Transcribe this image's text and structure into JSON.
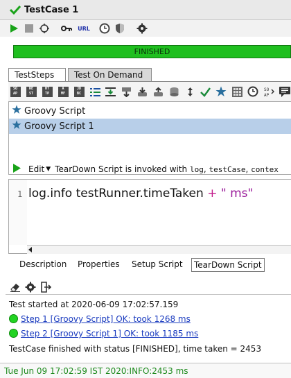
{
  "window": {
    "title": "TestCase 1"
  },
  "toolbar": {
    "icons": [
      "run-icon",
      "stop-icon",
      "loop-icon",
      "key-icon",
      "url-icon",
      "clock-icon",
      "shield-icon",
      "gear-icon"
    ],
    "url_label": "URL"
  },
  "progress": {
    "status": "FINISHED",
    "value": 1.0,
    "color": "#1fbf1f"
  },
  "tabs": [
    {
      "label": "TestSteps",
      "active": true
    },
    {
      "label": "Test On Demand",
      "active": false
    }
  ],
  "step_toolbar": {
    "block_icons": [
      {
        "name": "soap-request-icon",
        "l1": "SO",
        "l2": "AP"
      },
      {
        "name": "rest-request-icon",
        "l1": "RE",
        "l2": "ST"
      },
      {
        "name": "http-request-icon",
        "l1": "HT",
        "l2": "TP"
      },
      {
        "name": "amf-request-icon",
        "l1": "A",
        "l2": "MF"
      },
      {
        "name": "jdbc-request-icon",
        "l1": "JD",
        "l2": "BC"
      }
    ]
  },
  "steps": [
    {
      "label": "Groovy Script",
      "selected": false
    },
    {
      "label": "Groovy Script 1",
      "selected": true
    }
  ],
  "editor_bar": {
    "edit_label": "Edit",
    "desc_prefix": "TearDown Script is invoked with",
    "var1": "log",
    "sep1": ",",
    "var2": "testCase",
    "sep2": ",",
    "var3": "contex"
  },
  "editor": {
    "line_number": "1",
    "code_part1": "log.info testRunner.timeTaken",
    "code_op": "+",
    "code_str": "\" ms\""
  },
  "subtabs": [
    {
      "label": "Description",
      "active": false
    },
    {
      "label": "Properties",
      "active": false
    },
    {
      "label": "Setup Script",
      "active": false
    },
    {
      "label": "TearDown Script",
      "active": true
    }
  ],
  "log": {
    "started": "Test started at 2020-06-09 17:02:57.159",
    "step1": "Step 1 [Groovy Script] OK: took 1268 ms",
    "step2": "Step 2 [Groovy Script 1] OK: took 1185 ms",
    "finished": "TestCase finished with status [FINISHED], time taken = 2453"
  },
  "status_bar": {
    "text": "Tue Jun 09 17:02:59 IST 2020:INFO:2453 ms"
  }
}
